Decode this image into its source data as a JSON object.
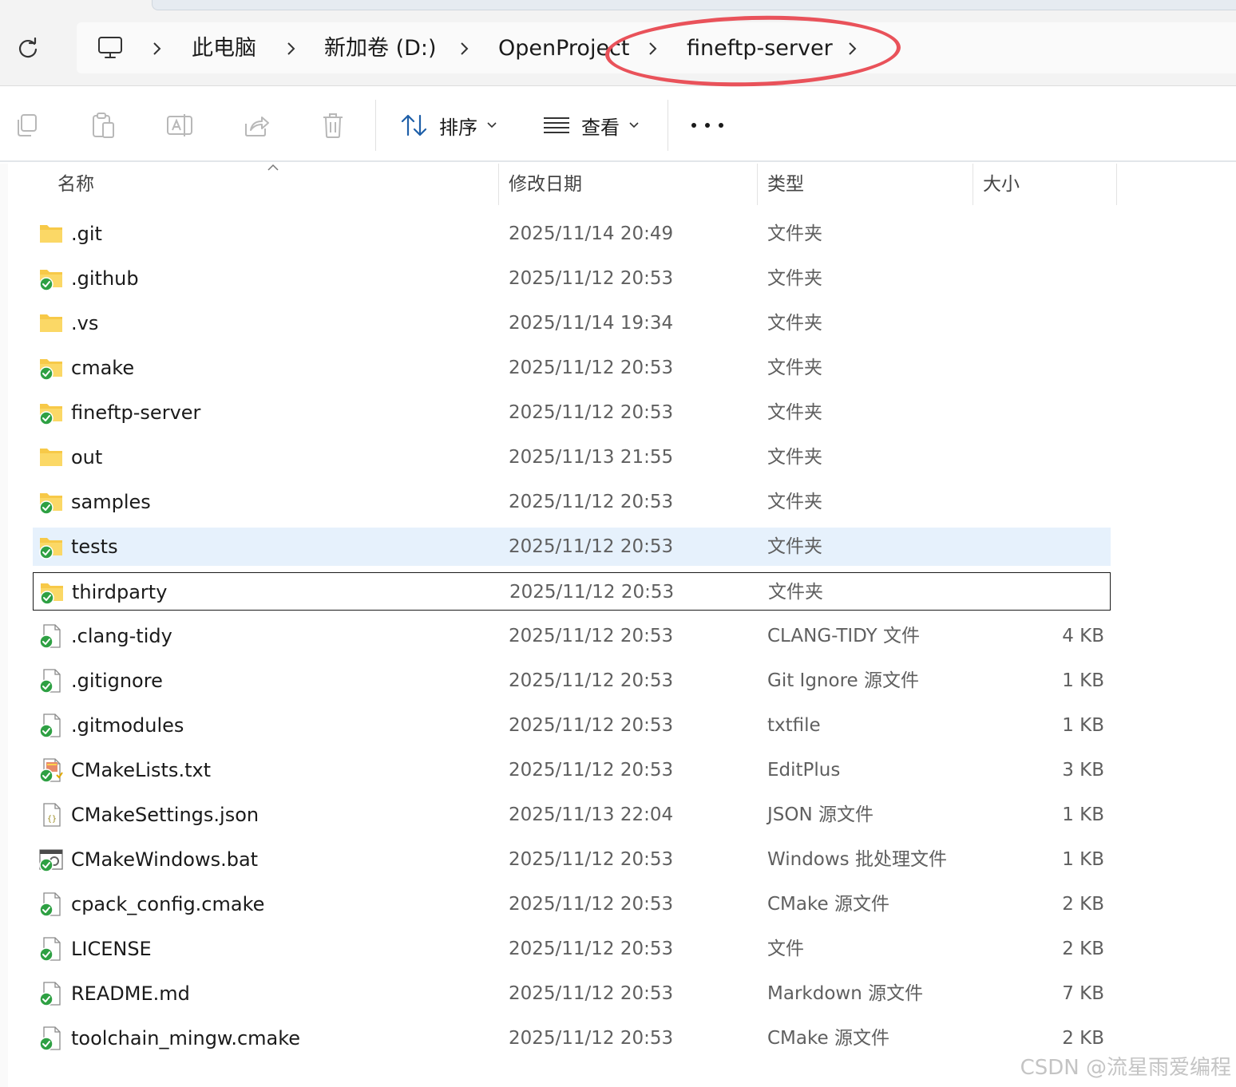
{
  "breadcrumb": {
    "items": [
      "此电脑",
      "新加卷 (D:)",
      "OpenProject",
      "fineftp-server"
    ]
  },
  "toolbar": {
    "sort_label": "排序",
    "view_label": "查看"
  },
  "columns": {
    "name": "名称",
    "date": "修改日期",
    "type": "类型",
    "size": "大小"
  },
  "files": [
    {
      "name": ".git",
      "date": "2025/11/14 20:49",
      "type": "文件夹",
      "size": "",
      "icon": "folder-icon"
    },
    {
      "name": ".github",
      "date": "2025/11/12 20:53",
      "type": "文件夹",
      "size": "",
      "icon": "folder-synced-icon"
    },
    {
      "name": ".vs",
      "date": "2025/11/14 19:34",
      "type": "文件夹",
      "size": "",
      "icon": "folder-icon"
    },
    {
      "name": "cmake",
      "date": "2025/11/12 20:53",
      "type": "文件夹",
      "size": "",
      "icon": "folder-synced-icon"
    },
    {
      "name": "fineftp-server",
      "date": "2025/11/12 20:53",
      "type": "文件夹",
      "size": "",
      "icon": "folder-synced-icon"
    },
    {
      "name": "out",
      "date": "2025/11/13 21:55",
      "type": "文件夹",
      "size": "",
      "icon": "folder-icon"
    },
    {
      "name": "samples",
      "date": "2025/11/12 20:53",
      "type": "文件夹",
      "size": "",
      "icon": "folder-synced-icon"
    },
    {
      "name": "tests",
      "date": "2025/11/12 20:53",
      "type": "文件夹",
      "size": "",
      "icon": "folder-synced-icon"
    },
    {
      "name": "thirdparty",
      "date": "2025/11/12 20:53",
      "type": "文件夹",
      "size": "",
      "icon": "folder-synced-icon"
    },
    {
      "name": ".clang-tidy",
      "date": "2025/11/12 20:53",
      "type": "CLANG-TIDY 文件",
      "size": "4 KB",
      "icon": "file-synced-icon"
    },
    {
      "name": ".gitignore",
      "date": "2025/11/12 20:53",
      "type": "Git Ignore 源文件",
      "size": "1 KB",
      "icon": "file-synced-icon"
    },
    {
      "name": ".gitmodules",
      "date": "2025/11/12 20:53",
      "type": "txtfile",
      "size": "1 KB",
      "icon": "file-synced-icon"
    },
    {
      "name": "CMakeLists.txt",
      "date": "2025/11/12 20:53",
      "type": "EditPlus",
      "size": "3 KB",
      "icon": "editplus-file-icon"
    },
    {
      "name": "CMakeSettings.json",
      "date": "2025/11/13 22:04",
      "type": "JSON 源文件",
      "size": "1 KB",
      "icon": "json-file-icon"
    },
    {
      "name": "CMakeWindows.bat",
      "date": "2025/11/12 20:53",
      "type": "Windows 批处理文件",
      "size": "1 KB",
      "icon": "batch-file-icon"
    },
    {
      "name": "cpack_config.cmake",
      "date": "2025/11/12 20:53",
      "type": "CMake 源文件",
      "size": "2 KB",
      "icon": "file-synced-icon"
    },
    {
      "name": "LICENSE",
      "date": "2025/11/12 20:53",
      "type": "文件",
      "size": "2 KB",
      "icon": "file-synced-icon"
    },
    {
      "name": "README.md",
      "date": "2025/11/12 20:53",
      "type": "Markdown 源文件",
      "size": "7 KB",
      "icon": "file-synced-icon"
    },
    {
      "name": "toolchain_mingw.cmake",
      "date": "2025/11/12 20:53",
      "type": "CMake 源文件",
      "size": "2 KB",
      "icon": "file-synced-icon"
    }
  ],
  "watermark": "CSDN @流星雨爱编程",
  "colors": {
    "hover_row": "#e6f1fc",
    "annotation_oval": "#e9525a",
    "folder": "#f7c948",
    "sync_check": "#2ea043"
  }
}
